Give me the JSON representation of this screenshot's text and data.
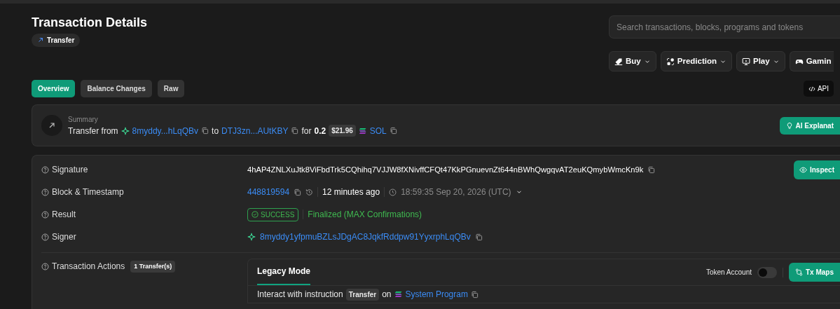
{
  "header": {
    "title": "Transaction Details",
    "type_badge": "Transfer"
  },
  "search": {
    "placeholder": "Search transactions, blocks, programs and tokens"
  },
  "nav_menus": [
    {
      "label": "Buy",
      "dropdown": true
    },
    {
      "label": "Prediction",
      "dropdown": true
    },
    {
      "label": "Play",
      "dropdown": true
    },
    {
      "label": "Gamin",
      "dropdown": false
    }
  ],
  "api_button": "API",
  "tabs": [
    {
      "label": "Overview",
      "selected": true
    },
    {
      "label": "Balance Changes",
      "selected": false
    },
    {
      "label": "Raw",
      "selected": false
    }
  ],
  "summary": {
    "label": "Summary",
    "ai_button": "AI Explanat",
    "parts": [
      {
        "kind": "text",
        "text": "Transfer from"
      },
      {
        "kind": "wallet",
        "text": "8myddy...hLqQBv"
      },
      {
        "kind": "text",
        "text": "to"
      },
      {
        "kind": "address",
        "text": "DTJ3zn...AUtKBY"
      },
      {
        "kind": "text",
        "text": "for"
      },
      {
        "kind": "amount",
        "text": "0.2"
      },
      {
        "kind": "price",
        "text": "$21.96"
      },
      {
        "kind": "token",
        "text": "SOL"
      }
    ]
  },
  "details": [
    {
      "kind": "signature",
      "label": "Signature",
      "value": "4hAP4ZNLXuJtk8ViFbdTrk5CQhihq7VJJW8fXNivffCFQt47KkPGnuevnZt644nBWhQwgqvAT2euKQmybWmcKn9k",
      "action": "Inspect"
    },
    {
      "kind": "block",
      "label": "Block & Timestamp",
      "block": "448819594",
      "age": "12 minutes ago",
      "timestamp": "18:59:35 Sep 20, 2026 (UTC)"
    },
    {
      "kind": "result",
      "label": "Result",
      "status": "SUCCESS",
      "confirmation": "Finalized (MAX Confirmations)"
    },
    {
      "kind": "signer",
      "label": "Signer",
      "address": "8myddy1yfpmuBZLsJDgAC8JqkfRddpw91YyxrphLqQBv"
    },
    {
      "kind": "actions",
      "label": "Transaction Actions",
      "count": "1 Transfer(s)",
      "panel": {
        "tabs": [
          {
            "label": "Legacy Mode",
            "selected": true
          }
        ],
        "toggle": {
          "label": "Token Account",
          "on": false
        },
        "maps_button": "Tx Maps",
        "instructions": [
          {
            "prefix": "Interact with instruction",
            "instruction": "Transfer",
            "joiner": "on",
            "program": "System Program"
          }
        ]
      }
    }
  ]
}
